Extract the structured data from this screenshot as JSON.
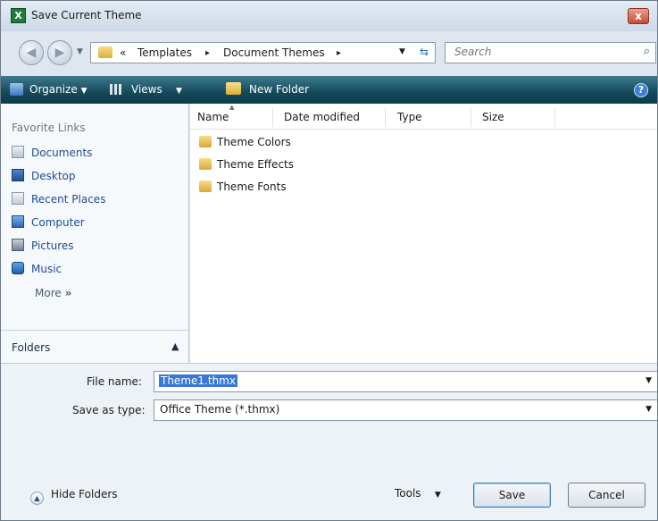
{
  "window": {
    "title": "Save Current Theme",
    "app_icon": "excel-icon",
    "close_glyph": "x"
  },
  "navigation": {
    "back_icon": "back-arrow-icon",
    "forward_icon": "forward-arrow-icon",
    "breadcrumb": [
      "«",
      "Templates",
      "▸",
      "Document Themes",
      "▸"
    ],
    "search_placeholder": "Search"
  },
  "toolbar": {
    "organize_label": "Organize",
    "views_label": "Views",
    "new_folder_label": "New Folder",
    "help_glyph": "?"
  },
  "nav_pane": {
    "heading": "Favorite Links",
    "items": [
      {
        "label": "Documents",
        "icon": "documents-icon"
      },
      {
        "label": "Desktop",
        "icon": "desktop-icon"
      },
      {
        "label": "Recent Places",
        "icon": "recent-places-icon"
      },
      {
        "label": "Computer",
        "icon": "computer-icon"
      },
      {
        "label": "Pictures",
        "icon": "pictures-icon"
      },
      {
        "label": "Music",
        "icon": "music-icon"
      }
    ],
    "more_label": "More",
    "more_glyph": "»",
    "folders_label": "Folders"
  },
  "file_list": {
    "columns": [
      "Name",
      "Date modified",
      "Type",
      "Size"
    ],
    "rows": [
      {
        "name": "Theme Colors"
      },
      {
        "name": "Theme Effects"
      },
      {
        "name": "Theme Fonts"
      }
    ]
  },
  "form": {
    "file_name_label": "File name:",
    "file_name_value": "Theme1.thmx",
    "save_type_label": "Save as type:",
    "save_type_value": "Office Theme (*.thmx)",
    "hide_folders_label": "Hide Folders",
    "tools_label": "Tools",
    "save_label": "Save",
    "cancel_label": "Cancel"
  },
  "colors": {
    "toolbar": "#14495b",
    "link_text": "#1c4b97",
    "selection": "#3a78d8",
    "close_button": "#c74a33"
  }
}
